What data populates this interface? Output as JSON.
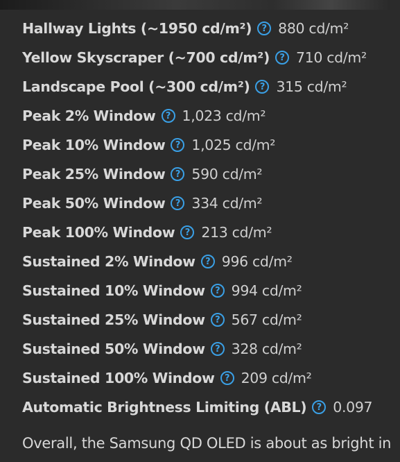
{
  "measurements": [
    {
      "label": "Hallway Lights (~1950 cd/m²)",
      "help_icon": "question-circle-icon",
      "value": "880 cd/m²"
    },
    {
      "label": "Yellow Skyscraper (~700 cd/m²)",
      "help_icon": "question-circle-icon",
      "value": "710 cd/m²"
    },
    {
      "label": "Landscape Pool (~300 cd/m²)",
      "help_icon": "question-circle-icon",
      "value": "315 cd/m²"
    },
    {
      "label": "Peak 2% Window",
      "help_icon": "question-circle-icon",
      "value": "1,023 cd/m²"
    },
    {
      "label": "Peak 10% Window",
      "help_icon": "question-circle-icon",
      "value": "1,025 cd/m²"
    },
    {
      "label": "Peak 25% Window",
      "help_icon": "question-circle-icon",
      "value": "590 cd/m²"
    },
    {
      "label": "Peak 50% Window",
      "help_icon": "question-circle-icon",
      "value": "334 cd/m²"
    },
    {
      "label": "Peak 100% Window",
      "help_icon": "question-circle-icon",
      "value": "213 cd/m²"
    },
    {
      "label": "Sustained 2% Window",
      "help_icon": "question-circle-icon",
      "value": "996 cd/m²"
    },
    {
      "label": "Sustained 10% Window",
      "help_icon": "question-circle-icon",
      "value": "994 cd/m²"
    },
    {
      "label": "Sustained 25% Window",
      "help_icon": "question-circle-icon",
      "value": "567 cd/m²"
    },
    {
      "label": "Sustained 50% Window",
      "help_icon": "question-circle-icon",
      "value": "328 cd/m²"
    },
    {
      "label": "Sustained 100% Window",
      "help_icon": "question-circle-icon",
      "value": "209 cd/m²"
    },
    {
      "label": "Automatic Brightness Limiting (ABL)",
      "help_icon": "question-circle-icon",
      "value": "0.097"
    }
  ],
  "help_glyph": "?",
  "paragraph": "Overall, the Samsung QD OLED is about as bright in",
  "colors": {
    "background": "#2b2b2b",
    "label": "#d8d8d8",
    "value": "#cfcfcf",
    "help_icon": "#3aa0e6"
  }
}
